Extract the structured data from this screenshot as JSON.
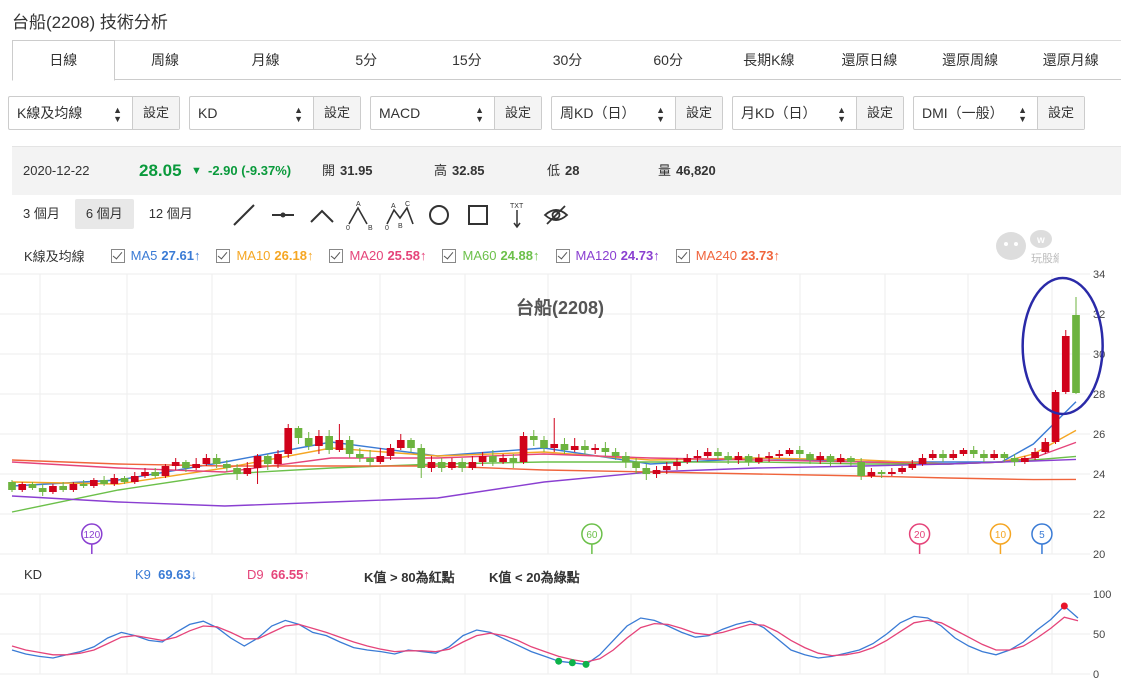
{
  "page_title": "台船(2208) 技術分析",
  "tabs": [
    "日線",
    "周線",
    "月線",
    "5分",
    "15分",
    "30分",
    "60分",
    "長期K線",
    "還原日線",
    "還原周線",
    "還原月線"
  ],
  "selects": [
    {
      "value": "K線及均線",
      "button": "設定"
    },
    {
      "value": "KD",
      "button": "設定"
    },
    {
      "value": "MACD",
      "button": "設定"
    },
    {
      "value": "周KD（日）",
      "button": "設定"
    },
    {
      "value": "月KD（日）",
      "button": "設定"
    },
    {
      "value": "DMI（一般）",
      "button": "設定"
    }
  ],
  "quote": {
    "date": "2020-12-22",
    "price": "28.05",
    "change": "-2.90 (-9.37%)",
    "open_label": "開",
    "open": "31.95",
    "high_label": "高",
    "high": "32.85",
    "low_label": "低",
    "low": "28",
    "vol_label": "量",
    "vol": "46,820"
  },
  "ranges": [
    "3 個月",
    "6 個月",
    "12 個月"
  ],
  "tool_icons": [
    "line-tool-icon",
    "hline-tool-icon",
    "wedge-tool-icon",
    "abc-pattern-icon",
    "abcd-pattern-icon",
    "circle-tool-icon",
    "rectangle-tool-icon",
    "text-tool-icon",
    "hide-drawings-icon"
  ],
  "legend": {
    "label": "K線及均線",
    "items": [
      {
        "name": "MA5",
        "value": "27.61↑",
        "color": "#3a7bd5"
      },
      {
        "name": "MA10",
        "value": "26.18↑",
        "color": "#f5a623"
      },
      {
        "name": "MA20",
        "value": "25.58↑",
        "color": "#e5447a"
      },
      {
        "name": "MA60",
        "value": "24.88↑",
        "color": "#6cc04a"
      },
      {
        "name": "MA120",
        "value": "24.73↑",
        "color": "#8a3fd1"
      },
      {
        "name": "MA240",
        "value": "23.73↑",
        "color": "#f0643c"
      }
    ]
  },
  "logo_text": "玩股網",
  "chart_data": [
    {
      "type": "candlestick",
      "title": "台船(2208)",
      "ylim": [
        20,
        34
      ],
      "yticks": [
        "20",
        "22",
        "24",
        "26",
        "28",
        "30",
        "32",
        "34"
      ],
      "markers": [
        {
          "label": "120",
          "color": "#8a3fd1",
          "pos": 0.075
        },
        {
          "label": "60",
          "color": "#6cc04a",
          "pos": 0.545
        },
        {
          "label": "20",
          "color": "#e5447a",
          "pos": 0.853
        },
        {
          "label": "10",
          "color": "#f5a623",
          "pos": 0.929
        },
        {
          "label": "5",
          "color": "#3a7bd5",
          "pos": 0.968
        }
      ],
      "candles": [
        [
          23.6,
          23.2,
          23.7,
          23.1
        ],
        [
          23.2,
          23.5,
          23.6,
          23.1
        ],
        [
          23.5,
          23.3,
          23.6,
          23.2
        ],
        [
          23.3,
          23.1,
          23.5,
          22.9
        ],
        [
          23.1,
          23.4,
          23.5,
          23.0
        ],
        [
          23.4,
          23.2,
          23.6,
          23.1
        ],
        [
          23.2,
          23.5,
          23.6,
          23.1
        ],
        [
          23.5,
          23.4,
          23.7,
          23.3
        ],
        [
          23.4,
          23.7,
          23.8,
          23.3
        ],
        [
          23.7,
          23.5,
          23.9,
          23.4
        ],
        [
          23.5,
          23.8,
          24.0,
          23.4
        ],
        [
          23.8,
          23.6,
          23.9,
          23.5
        ],
        [
          23.6,
          23.9,
          24.1,
          23.5
        ],
        [
          23.9,
          24.1,
          24.3,
          23.8
        ],
        [
          24.1,
          23.9,
          24.3,
          23.8
        ],
        [
          23.9,
          24.4,
          24.5,
          23.8
        ],
        [
          24.4,
          24.6,
          24.8,
          24.2
        ],
        [
          24.6,
          24.3,
          24.7,
          24.1
        ],
        [
          24.3,
          24.5,
          24.8,
          24.2
        ],
        [
          24.5,
          24.8,
          25.0,
          24.4
        ],
        [
          24.8,
          24.5,
          25.0,
          24.3
        ],
        [
          24.5,
          24.3,
          24.7,
          24.1
        ],
        [
          24.3,
          24.0,
          24.5,
          23.7
        ],
        [
          24.0,
          24.3,
          24.6,
          23.9
        ],
        [
          24.3,
          24.9,
          25.0,
          23.5
        ],
        [
          24.9,
          24.5,
          25.0,
          24.2
        ],
        [
          24.5,
          25.0,
          25.2,
          24.3
        ],
        [
          25.0,
          26.3,
          26.5,
          24.8
        ],
        [
          26.3,
          25.8,
          26.4,
          25.5
        ],
        [
          25.8,
          25.4,
          26.1,
          25.2
        ],
        [
          25.4,
          25.9,
          26.2,
          25.0
        ],
        [
          25.9,
          25.2,
          26.2,
          25.0
        ],
        [
          25.2,
          25.7,
          26.5,
          25.1
        ],
        [
          25.7,
          25.0,
          25.9,
          24.8
        ],
        [
          25.0,
          24.8,
          25.3,
          24.6
        ],
        [
          24.8,
          24.6,
          25.2,
          24.4
        ],
        [
          24.6,
          24.9,
          25.3,
          24.5
        ],
        [
          24.9,
          25.3,
          25.5,
          24.7
        ],
        [
          25.3,
          25.7,
          26.0,
          25.2
        ],
        [
          25.7,
          25.3,
          25.8,
          25.1
        ],
        [
          25.3,
          24.3,
          25.5,
          23.8
        ],
        [
          24.3,
          24.6,
          24.9,
          24.1
        ],
        [
          24.6,
          24.3,
          24.8,
          24.1
        ],
        [
          24.3,
          24.6,
          24.8,
          24.2
        ],
        [
          24.6,
          24.3,
          24.8,
          24.1
        ],
        [
          24.3,
          24.6,
          24.9,
          24.2
        ],
        [
          24.6,
          24.9,
          25.1,
          24.4
        ],
        [
          24.9,
          24.6,
          25.2,
          24.4
        ],
        [
          24.6,
          24.8,
          25.0,
          24.5
        ],
        [
          24.8,
          24.6,
          25.0,
          24.3
        ],
        [
          24.6,
          25.9,
          26.1,
          24.5
        ],
        [
          25.9,
          25.7,
          26.2,
          25.4
        ],
        [
          25.7,
          25.3,
          25.9,
          25.1
        ],
        [
          25.3,
          25.5,
          26.8,
          25.1
        ],
        [
          25.5,
          25.2,
          25.8,
          25.0
        ],
        [
          25.2,
          25.4,
          25.8,
          25.1
        ],
        [
          25.4,
          25.2,
          25.7,
          25.0
        ],
        [
          25.2,
          25.3,
          25.5,
          25.0
        ],
        [
          25.3,
          25.1,
          25.6,
          24.9
        ],
        [
          25.1,
          24.9,
          25.3,
          24.7
        ],
        [
          24.9,
          24.6,
          25.1,
          24.3
        ],
        [
          24.6,
          24.3,
          24.8,
          24.0
        ],
        [
          24.3,
          24.0,
          24.5,
          23.7
        ],
        [
          24.0,
          24.2,
          24.4,
          23.8
        ],
        [
          24.2,
          24.4,
          24.6,
          24.0
        ],
        [
          24.4,
          24.6,
          24.8,
          24.2
        ],
        [
          24.6,
          24.8,
          25.0,
          24.5
        ],
        [
          24.8,
          24.9,
          25.2,
          24.6
        ],
        [
          24.9,
          25.1,
          25.3,
          24.8
        ],
        [
          25.1,
          24.9,
          25.3,
          24.7
        ],
        [
          24.9,
          24.7,
          25.1,
          24.5
        ],
        [
          24.7,
          24.9,
          25.1,
          24.5
        ],
        [
          24.9,
          24.6,
          25.0,
          24.4
        ],
        [
          24.6,
          24.8,
          25.0,
          24.5
        ],
        [
          24.8,
          24.9,
          25.1,
          24.6
        ],
        [
          24.9,
          25.0,
          25.2,
          24.8
        ],
        [
          25.0,
          25.2,
          25.3,
          24.9
        ],
        [
          25.2,
          25.0,
          25.4,
          24.8
        ],
        [
          25.0,
          24.7,
          25.1,
          24.5
        ],
        [
          24.7,
          24.9,
          25.1,
          24.5
        ],
        [
          24.9,
          24.6,
          25.0,
          24.4
        ],
        [
          24.6,
          24.8,
          25.0,
          24.5
        ],
        [
          24.8,
          24.6,
          24.9,
          24.4
        ],
        [
          24.6,
          23.9,
          24.8,
          23.7
        ],
        [
          23.9,
          24.1,
          24.3,
          23.8
        ],
        [
          24.1,
          24.0,
          24.2,
          23.8
        ],
        [
          24.0,
          24.1,
          24.3,
          23.9
        ],
        [
          24.1,
          24.3,
          24.4,
          24.0
        ],
        [
          24.3,
          24.5,
          24.7,
          24.2
        ],
        [
          24.5,
          24.8,
          25.0,
          24.4
        ],
        [
          24.8,
          25.0,
          25.2,
          24.7
        ],
        [
          25.0,
          24.8,
          25.2,
          24.6
        ],
        [
          24.8,
          25.0,
          25.2,
          24.7
        ],
        [
          25.0,
          25.2,
          25.3,
          24.9
        ],
        [
          25.2,
          25.0,
          25.4,
          24.8
        ],
        [
          25.0,
          24.8,
          25.2,
          24.6
        ],
        [
          24.8,
          25.0,
          25.2,
          24.7
        ],
        [
          25.0,
          24.8,
          25.1,
          24.6
        ],
        [
          24.8,
          24.6,
          25.0,
          24.4
        ],
        [
          24.6,
          24.8,
          24.9,
          24.5
        ],
        [
          24.8,
          25.1,
          25.3,
          24.7
        ],
        [
          25.1,
          25.6,
          25.8,
          25.0
        ],
        [
          25.6,
          28.1,
          28.2,
          25.5
        ],
        [
          28.1,
          30.9,
          31.2,
          28.0
        ],
        [
          31.95,
          28.05,
          32.85,
          28.0
        ]
      ],
      "ma": {
        "MA5": [
          [
            0,
            23.4
          ],
          [
            0.1,
            23.7
          ],
          [
            0.2,
            24.6
          ],
          [
            0.3,
            25.6
          ],
          [
            0.4,
            24.9
          ],
          [
            0.5,
            25.3
          ],
          [
            0.6,
            24.5
          ],
          [
            0.7,
            24.8
          ],
          [
            0.8,
            24.6
          ],
          [
            0.88,
            24.6
          ],
          [
            0.93,
            24.6
          ],
          [
            0.96,
            25.5
          ],
          [
            1.0,
            27.61
          ]
        ],
        "MA10": [
          [
            0,
            23.6
          ],
          [
            0.1,
            23.5
          ],
          [
            0.2,
            24.3
          ],
          [
            0.3,
            25.3
          ],
          [
            0.4,
            24.9
          ],
          [
            0.5,
            25.1
          ],
          [
            0.6,
            24.7
          ],
          [
            0.7,
            24.8
          ],
          [
            0.8,
            24.7
          ],
          [
            0.88,
            24.5
          ],
          [
            0.93,
            24.6
          ],
          [
            0.96,
            25.0
          ],
          [
            1.0,
            26.18
          ]
        ],
        "MA20": [
          [
            0,
            24.6
          ],
          [
            0.1,
            24.3
          ],
          [
            0.2,
            24.1
          ],
          [
            0.3,
            24.8
          ],
          [
            0.4,
            24.8
          ],
          [
            0.5,
            25.0
          ],
          [
            0.6,
            24.8
          ],
          [
            0.7,
            24.7
          ],
          [
            0.8,
            24.6
          ],
          [
            0.88,
            24.5
          ],
          [
            0.93,
            24.6
          ],
          [
            0.96,
            24.8
          ],
          [
            1.0,
            25.58
          ]
        ],
        "MA60": [
          [
            0,
            22.1
          ],
          [
            0.1,
            23.2
          ],
          [
            0.2,
            24.0
          ],
          [
            0.3,
            24.3
          ],
          [
            0.4,
            24.5
          ],
          [
            0.5,
            24.6
          ],
          [
            0.6,
            24.6
          ],
          [
            0.7,
            24.6
          ],
          [
            0.8,
            24.5
          ],
          [
            0.88,
            24.5
          ],
          [
            0.93,
            24.6
          ],
          [
            0.96,
            24.7
          ],
          [
            1.0,
            24.88
          ]
        ],
        "MA120": [
          [
            0,
            22.9
          ],
          [
            0.1,
            22.6
          ],
          [
            0.2,
            22.4
          ],
          [
            0.3,
            22.6
          ],
          [
            0.4,
            22.8
          ],
          [
            0.5,
            23.6
          ],
          [
            0.6,
            24.1
          ],
          [
            0.7,
            24.3
          ],
          [
            0.8,
            24.4
          ],
          [
            0.88,
            24.5
          ],
          [
            0.93,
            24.6
          ],
          [
            0.96,
            24.65
          ],
          [
            1.0,
            24.73
          ]
        ],
        "MA240": [
          [
            0,
            24.7
          ],
          [
            0.1,
            24.5
          ],
          [
            0.2,
            24.4
          ],
          [
            0.3,
            24.4
          ],
          [
            0.4,
            24.4
          ],
          [
            0.5,
            24.2
          ],
          [
            0.6,
            24.1
          ],
          [
            0.7,
            24.0
          ],
          [
            0.8,
            23.9
          ],
          [
            0.88,
            23.8
          ],
          [
            0.93,
            23.75
          ],
          [
            0.96,
            23.72
          ],
          [
            1.0,
            23.73
          ]
        ]
      }
    },
    {
      "type": "line",
      "title": "KD",
      "ylim": [
        0,
        100
      ],
      "yticks": [
        "0",
        "50",
        "100"
      ],
      "series": [
        {
          "name": "K9",
          "value": "69.63↓",
          "color": "#3a7bd5",
          "values": [
            30,
            25,
            22,
            20,
            24,
            28,
            34,
            45,
            52,
            48,
            42,
            40,
            52,
            62,
            66,
            58,
            45,
            35,
            45,
            60,
            67,
            62,
            52,
            48,
            40,
            33,
            30,
            28,
            25,
            30,
            28,
            26,
            34,
            48,
            55,
            52,
            44,
            36,
            28,
            22,
            16,
            14,
            12,
            24,
            42,
            60,
            70,
            67,
            60,
            52,
            46,
            48,
            56,
            62,
            66,
            58,
            44,
            30,
            24,
            20,
            22,
            26,
            30,
            38,
            50,
            64,
            72,
            70,
            60,
            45,
            35,
            28,
            24,
            30,
            40,
            55,
            68,
            85,
            70
          ]
        },
        {
          "name": "D9",
          "value": "66.55↑",
          "color": "#e5447a",
          "values": [
            35,
            30,
            27,
            24,
            24,
            26,
            30,
            38,
            46,
            48,
            45,
            42,
            46,
            54,
            60,
            59,
            52,
            44,
            44,
            52,
            60,
            62,
            57,
            52,
            46,
            40,
            35,
            31,
            28,
            29,
            29,
            28,
            31,
            40,
            48,
            51,
            48,
            42,
            34,
            28,
            22,
            18,
            15,
            19,
            30,
            45,
            58,
            63,
            62,
            57,
            51,
            49,
            52,
            57,
            62,
            61,
            53,
            42,
            33,
            26,
            23,
            24,
            27,
            33,
            42,
            53,
            64,
            67,
            64,
            55,
            46,
            37,
            30,
            30,
            35,
            45,
            57,
            71,
            66.55
          ]
        }
      ],
      "notes": [
        "K值 > 80為紅點",
        "K值 < 20為綠點"
      ]
    }
  ]
}
